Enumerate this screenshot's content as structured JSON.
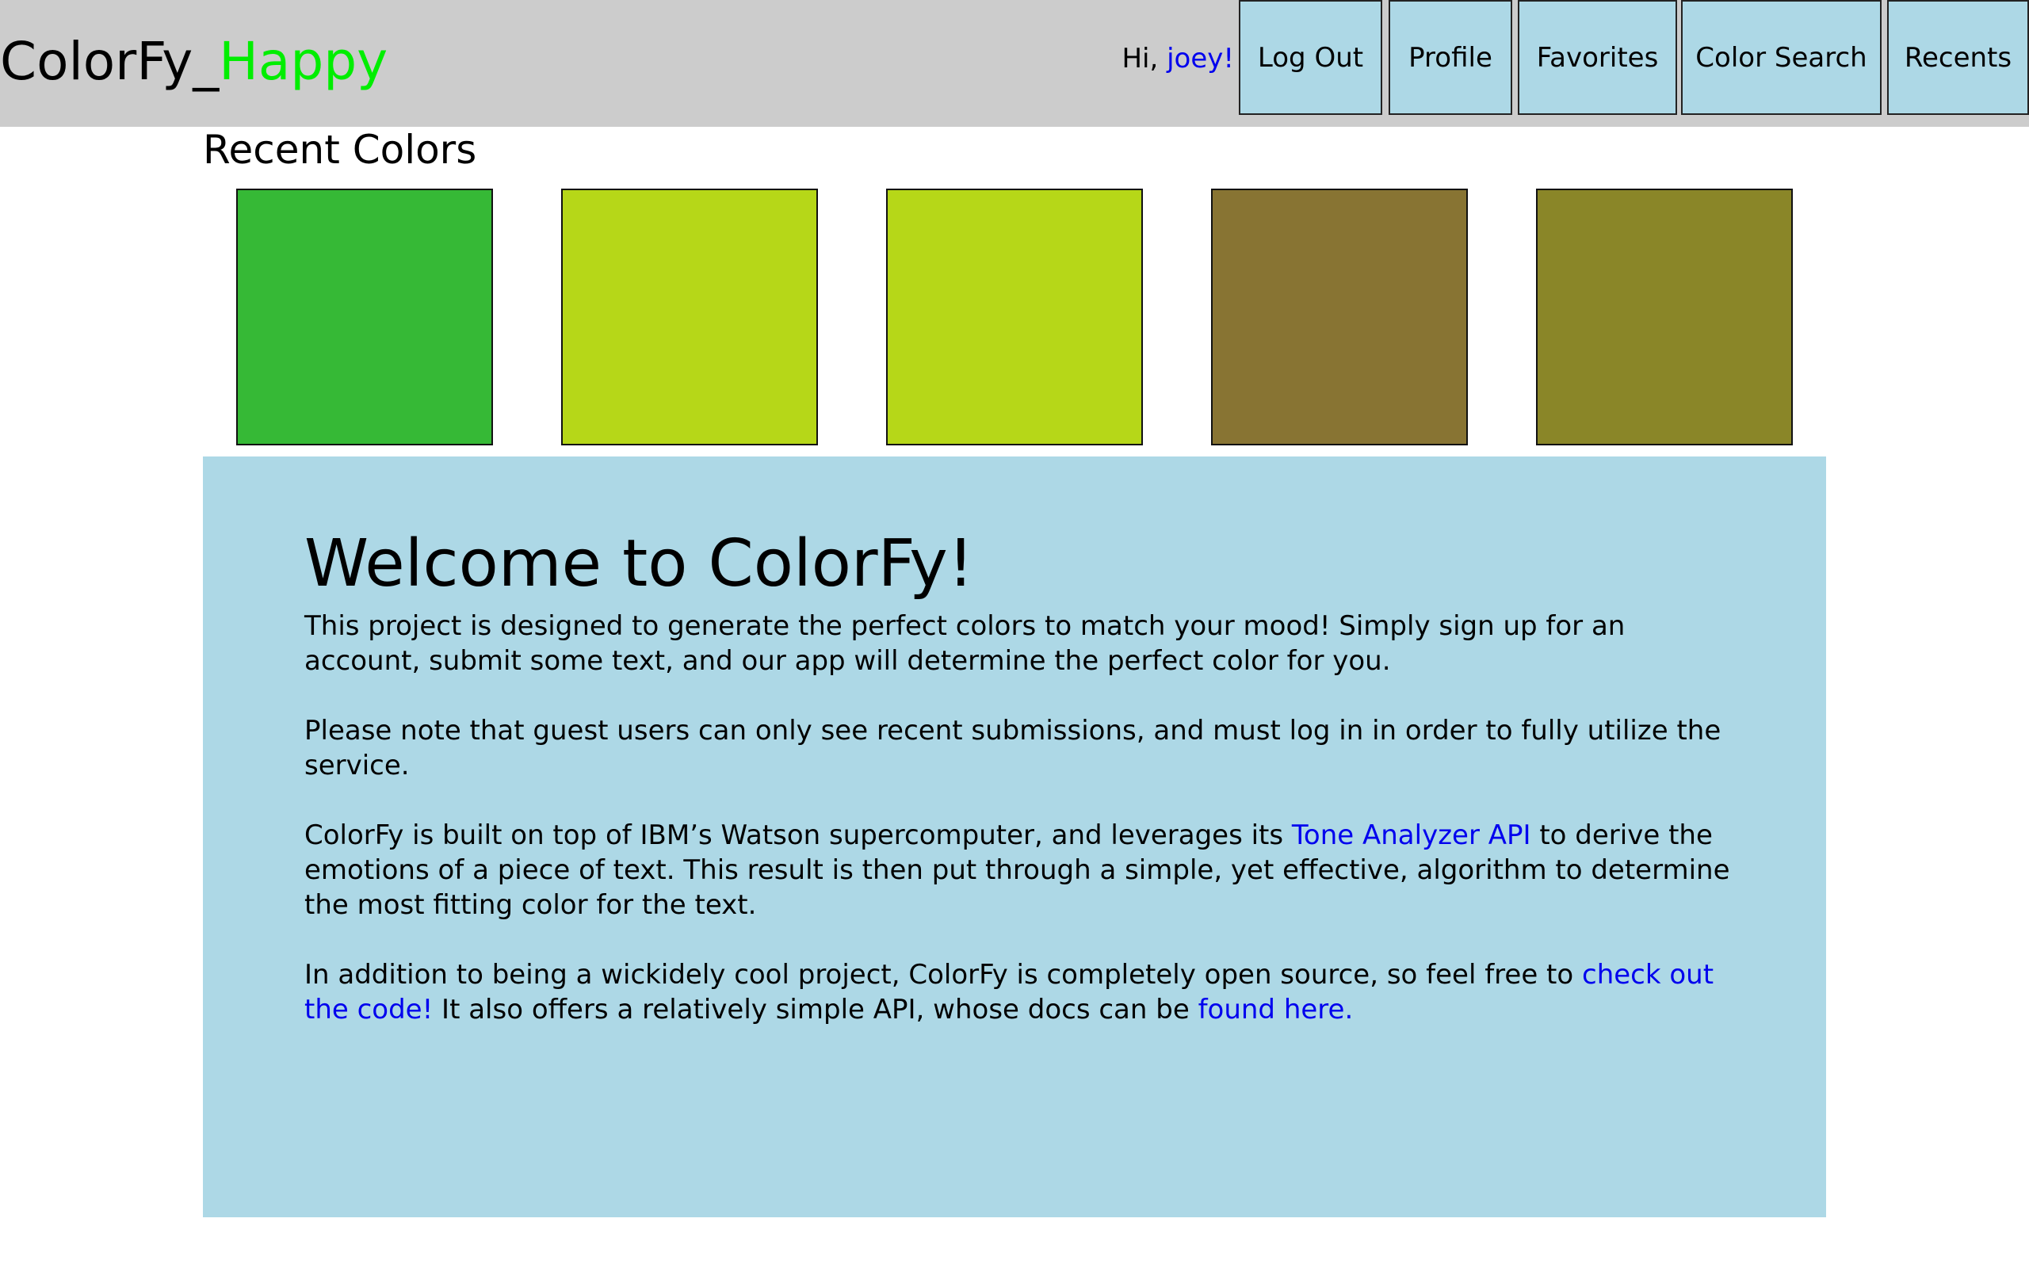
{
  "header": {
    "brand_name": "ColorFy_",
    "brand_mood": "Happy",
    "greeting_prefix": "Hi, ",
    "username": "joey!",
    "nav": [
      {
        "label": "Log Out"
      },
      {
        "label": "Profile"
      },
      {
        "label": "Favorites"
      },
      {
        "label": "Color Search"
      },
      {
        "label": "Recents"
      }
    ]
  },
  "recent": {
    "title": "Recent Colors",
    "swatches": [
      {
        "color": "#36b936"
      },
      {
        "color": "#b6d718"
      },
      {
        "color": "#b6d718"
      },
      {
        "color": "#887433"
      },
      {
        "color": "#8a8628"
      }
    ]
  },
  "welcome": {
    "title": "Welcome to ColorFy!",
    "p1": "This project is designed to generate the perfect colors to match your mood! Simply sign up for an account, submit some text, and our app will determine the perfect color for you.",
    "p2": "Please note that guest users can only see recent submissions, and must log in in order to fully utilize the service.",
    "p3_before": "ColorFy is built on top of IBM’s Watson supercomputer, and leverages its ",
    "p3_link": "Tone Analyzer API",
    "p3_after": " to derive the emotions of a piece of text. This result is then put through a simple, yet effective, algorithm to determine the most fitting color for the text.",
    "p4_before": "In addition to being a wickidely cool project, ColorFy is completely open source, so feel free to ",
    "p4_link1": "check out the code!",
    "p4_middle": " It also offers a relatively simple API, whose docs can be ",
    "p4_link2": "found here."
  },
  "colors": {
    "header_bg": "#cccccc",
    "nav_bg": "#add8e6",
    "panel_bg": "#add8e6",
    "link": "#0000ee",
    "mood": "#00ee00"
  }
}
